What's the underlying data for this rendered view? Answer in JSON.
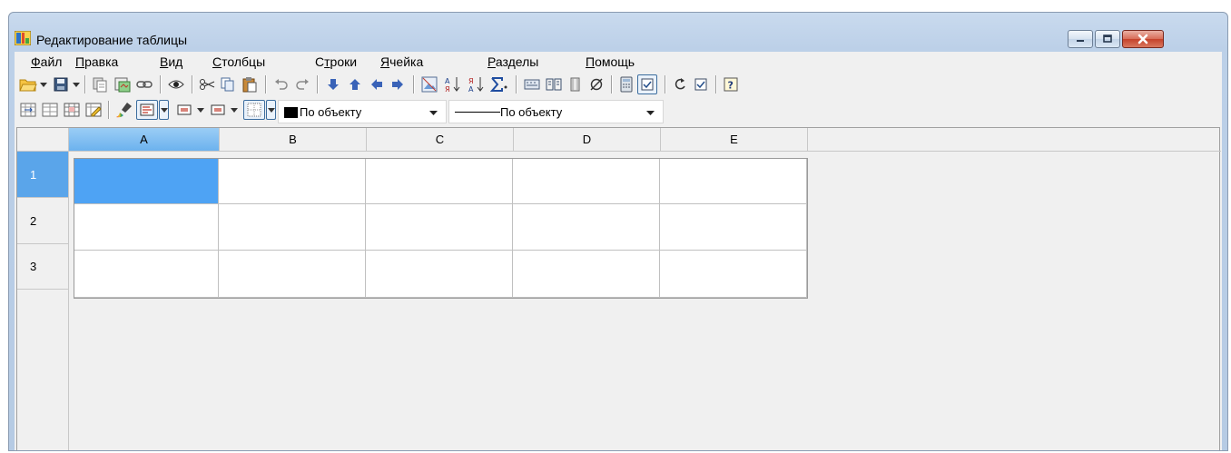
{
  "window": {
    "title": "Редактирование таблицы",
    "icon": "table-edit-app-icon",
    "controls": [
      "minimize-icon",
      "maximize-icon",
      "close-icon"
    ]
  },
  "menu": {
    "items": [
      {
        "accel": "Ф",
        "rest": "айл"
      },
      {
        "accel": "П",
        "rest": "равка"
      },
      {
        "accel": "В",
        "rest": "ид"
      },
      {
        "accel": "С",
        "rest": "толбцы"
      },
      {
        "pre": "С",
        "accel": "т",
        "rest": "роки"
      },
      {
        "accel": "Я",
        "rest": "чейка"
      },
      {
        "accel": "Р",
        "rest": "азделы"
      },
      {
        "accel": "П",
        "rest": "омощь"
      }
    ]
  },
  "toolbar2": {
    "fill_color_combo": "По объекту",
    "line_style_combo": "По объекту"
  },
  "sheet": {
    "columns": [
      "A",
      "B",
      "C",
      "D",
      "E"
    ],
    "rows": [
      "1",
      "2",
      "3"
    ],
    "selected_cell": "A1"
  },
  "colors": {
    "selection": "#4ea3f4",
    "header_selected": "#6cb2ee",
    "close_button": "#c5412a"
  }
}
